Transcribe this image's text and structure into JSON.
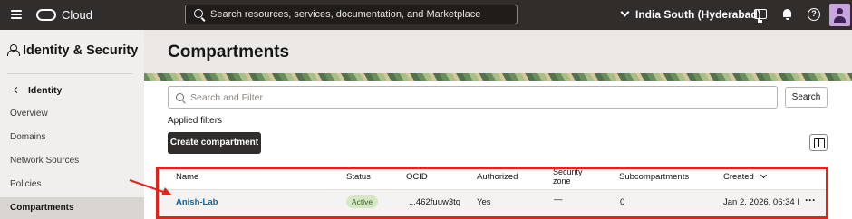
{
  "topbar": {
    "brand": "Cloud",
    "search_placeholder": "Search resources, services, documentation, and Marketplace",
    "region": "India South (Hyderabad)",
    "help_glyph": "?"
  },
  "sidebar": {
    "title": "Identity & Security",
    "back_label": "Identity",
    "items": [
      {
        "label": "Overview"
      },
      {
        "label": "Domains"
      },
      {
        "label": "Network Sources"
      },
      {
        "label": "Policies"
      },
      {
        "label": "Compartments",
        "active": true
      }
    ]
  },
  "main": {
    "page_title": "Compartments",
    "filter_placeholder": "Search and Filter",
    "search_button": "Search",
    "applied_filters": "Applied filters",
    "create_button": "Create compartment"
  },
  "table": {
    "columns": [
      "Name",
      "Status",
      "OCID",
      "Authorized",
      "Security zone",
      "Subcompartments",
      "Created"
    ],
    "rows": [
      {
        "name": "Anish-Lab",
        "status": "Active",
        "ocid": "...462fuuw3tq",
        "authorized": "Yes",
        "security_zone": "—",
        "subcompartments": "0",
        "created": "Jan 2, 2026, 06:34 I"
      }
    ]
  },
  "colors": {
    "topbar_bg": "#312d2a",
    "link": "#1060a0",
    "highlight": "#e2231a",
    "badge_bg": "#d4e8c5"
  },
  "icons": [
    "hamburger-icon",
    "oracle-logo-icon",
    "search-icon",
    "console-icon",
    "bell-icon",
    "help-icon",
    "user-icon",
    "identity-icon",
    "chevron-left-icon",
    "columns-icon",
    "chevron-down-icon",
    "kebab-menu-icon"
  ]
}
